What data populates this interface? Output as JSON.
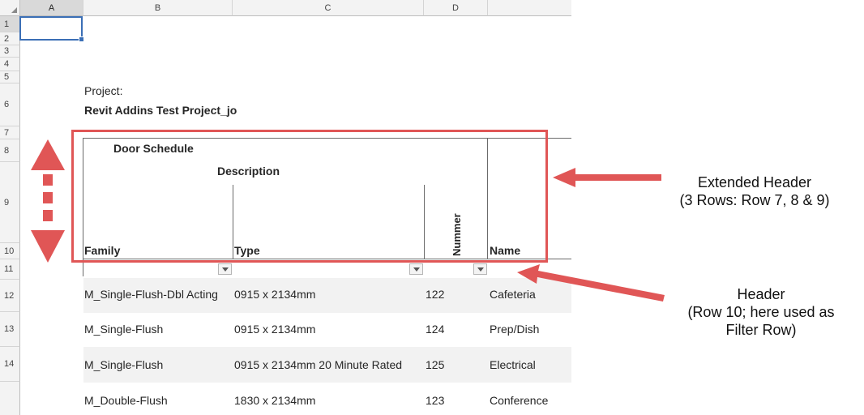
{
  "columns": [
    "A",
    "B",
    "C",
    "D"
  ],
  "rows": [
    "1",
    "2",
    "3",
    "4",
    "5",
    "6",
    "7",
    "8",
    "9",
    "10",
    "11",
    "12",
    "13",
    "14"
  ],
  "project_label": "Project:",
  "project_name": "Revit Addins Test Project_jo",
  "schedule_title": "Door Schedule",
  "description_label": "Description",
  "headers": {
    "family": "Family",
    "type": "Type",
    "nummer": "Nummer",
    "name": "Name"
  },
  "data_rows": [
    {
      "family": "M_Single-Flush-Dbl Acting",
      "type": "0915 x 2134mm",
      "nummer": "122",
      "name": "Cafeteria"
    },
    {
      "family": "M_Single-Flush",
      "type": "0915 x 2134mm",
      "nummer": "124",
      "name": "Prep/Dish"
    },
    {
      "family": "M_Single-Flush",
      "type": "0915 x 2134mm 20 Minute Rated",
      "nummer": "125",
      "name": "Electrical"
    },
    {
      "family": "M_Double-Flush",
      "type": "1830 x 2134mm",
      "nummer": "123",
      "name": "Conference"
    }
  ],
  "annotations": {
    "extended_header_title": "Extended Header",
    "extended_header_detail": "(3 Rows: Row 7, 8 & 9)",
    "header_title": "Header",
    "header_detail_1": "(Row 10; here used as",
    "header_detail_2": "Filter Row)"
  },
  "colors": {
    "annotation_red": "#e05656",
    "selection_blue": "#3b6fb6",
    "band_gray": "#f2f2f2"
  }
}
